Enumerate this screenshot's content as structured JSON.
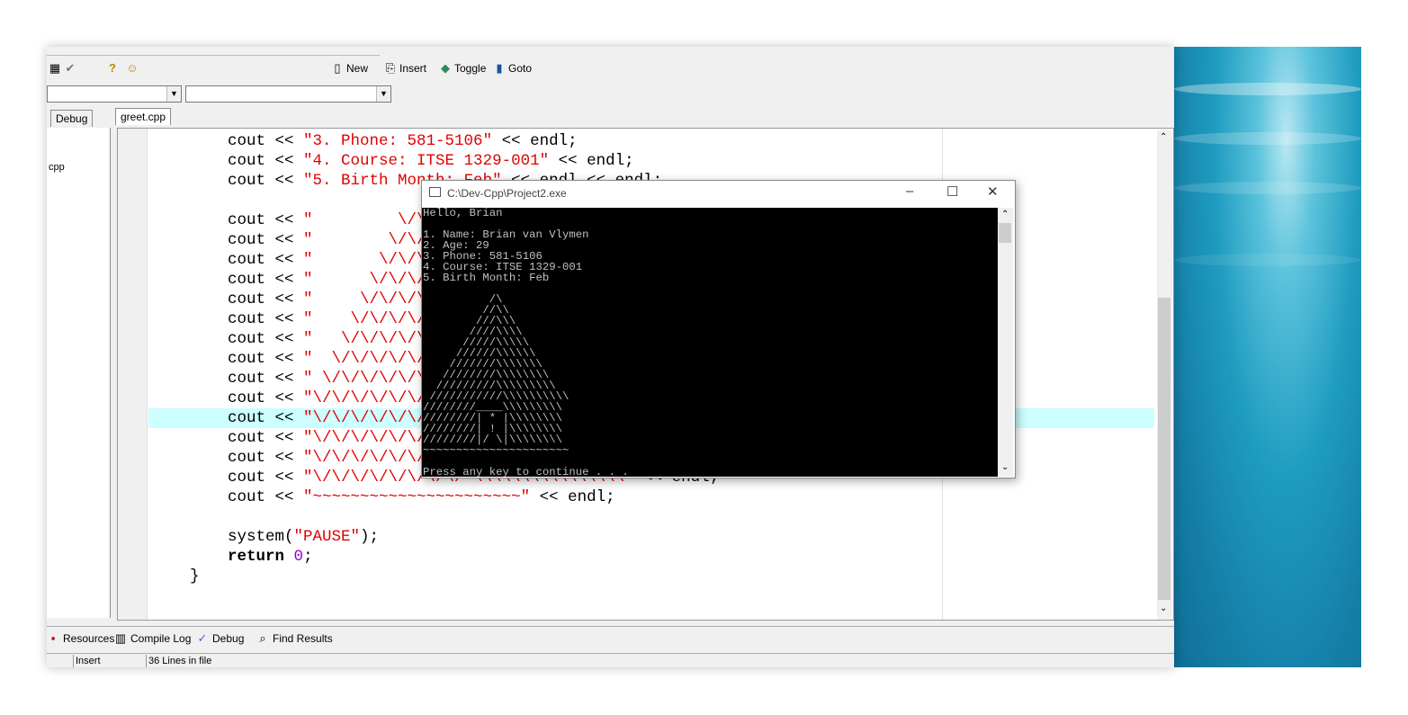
{
  "toolbar": {
    "new_label": "New",
    "insert_label": "Insert",
    "toggle_label": "Toggle",
    "goto_label": "Goto"
  },
  "tabs": {
    "debug_tab": "Debug",
    "file_tab": "greet.cpp"
  },
  "class_browser": {
    "item": "cpp"
  },
  "code_lines": [
    [
      "    cout << ",
      "\"3. Phone: 581-5106\"",
      " << endl;"
    ],
    [
      "    cout << ",
      "\"4. Course: ITSE 1329-001\"",
      " << endl;"
    ],
    [
      "    cout << ",
      "\"5. Birth Month: Feb\"",
      " << endl << endl;"
    ],
    [
      "",
      "",
      ""
    ],
    [
      "    cout << ",
      "\"         \\/\\\\\"",
      ""
    ],
    [
      "    cout << ",
      "\"        \\/\\/\\\\",
      ""
    ],
    [
      "    cout << ",
      "\"       \\/\\/\\/\\",
      ""
    ],
    [
      "    cout << ",
      "\"      \\/\\/\\/\\/",
      ""
    ],
    [
      "    cout << ",
      "\"     \\/\\/\\/\\/\\/",
      ""
    ],
    [
      "    cout << ",
      "\"    \\/\\/\\/\\/\\/",
      ""
    ],
    [
      "    cout << ",
      "\"   \\/\\/\\/\\/\\/\\/",
      ""
    ],
    [
      "    cout << ",
      "\"  \\/\\/\\/\\/\\/\\/",
      ""
    ],
    [
      "    cout << ",
      "\" \\/\\/\\/\\/\\/\\/\\",
      ""
    ],
    [
      "    cout << ",
      "\"\\/\\/\\/\\/\\/\\/\\/",
      ""
    ],
    [
      "    cout << ",
      "\"\\/\\/\\/\\/\\/\\/\\/",
      ""
    ],
    [
      "    cout << ",
      "\"\\/\\/\\/\\/\\/\\/\\/",
      ""
    ],
    [
      "    cout << ",
      "\"\\/\\/\\/\\/\\/\\/\\/",
      ""
    ],
    [
      "    cout << ",
      "\"\\/\\/\\/\\/\\/\\/\\/\\/ \\\\\\\\\\\\\\\\\\\\\\\\\\\\\\\\\"",
      " << endl;"
    ],
    [
      "    cout << ",
      "\"~~~~~~~~~~~~~~~~~~~~~~\"",
      " << endl;"
    ],
    [
      "",
      "",
      ""
    ],
    [
      "    system(",
      "\"PAUSE\"",
      ");"
    ]
  ],
  "code_return": {
    "kw": "return",
    "num": "0",
    "tail": ";"
  },
  "code_close": "}",
  "bottom_tabs": [
    "Resources",
    "Compile Log",
    "Debug",
    "Find Results"
  ],
  "status": {
    "mode": "Insert",
    "lines": "36 Lines in file"
  },
  "console": {
    "title": "C:\\Dev-Cpp\\Project2.exe",
    "output": "Hello, Brian\n\n1. Name: Brian van Vlymen\n2. Age: 29\n3. Phone: 581-5106\n4. Course: ITSE 1329-001\n5. Birth Month: Feb\n\n          /\\\n         //\\\\\n        ///\\\\\\\n       ////\\\\\\\\\n      /////\\\\\\\\\\\n     //////\\\\\\\\\\\\\n    ///////\\\\\\\\\\\\\\\n   ////////\\\\\\\\\\\\\\\\\n  /////////\\\\\\\\\\\\\\\\\\\n ///////////\\\\\\\\\\\\\\\\\\\\\n////////____\\\\\\\\\\\\\\\\\\\n////////| * |\\\\\\\\\\\\\\\\\n////////| ! |\\\\\\\\\\\\\\\\\n////////|/ \\|\\\\\\\\\\\\\\\\\n~~~~~~~~~~~~~~~~~~~~~~\n\nPress any key to continue . . ."
  }
}
